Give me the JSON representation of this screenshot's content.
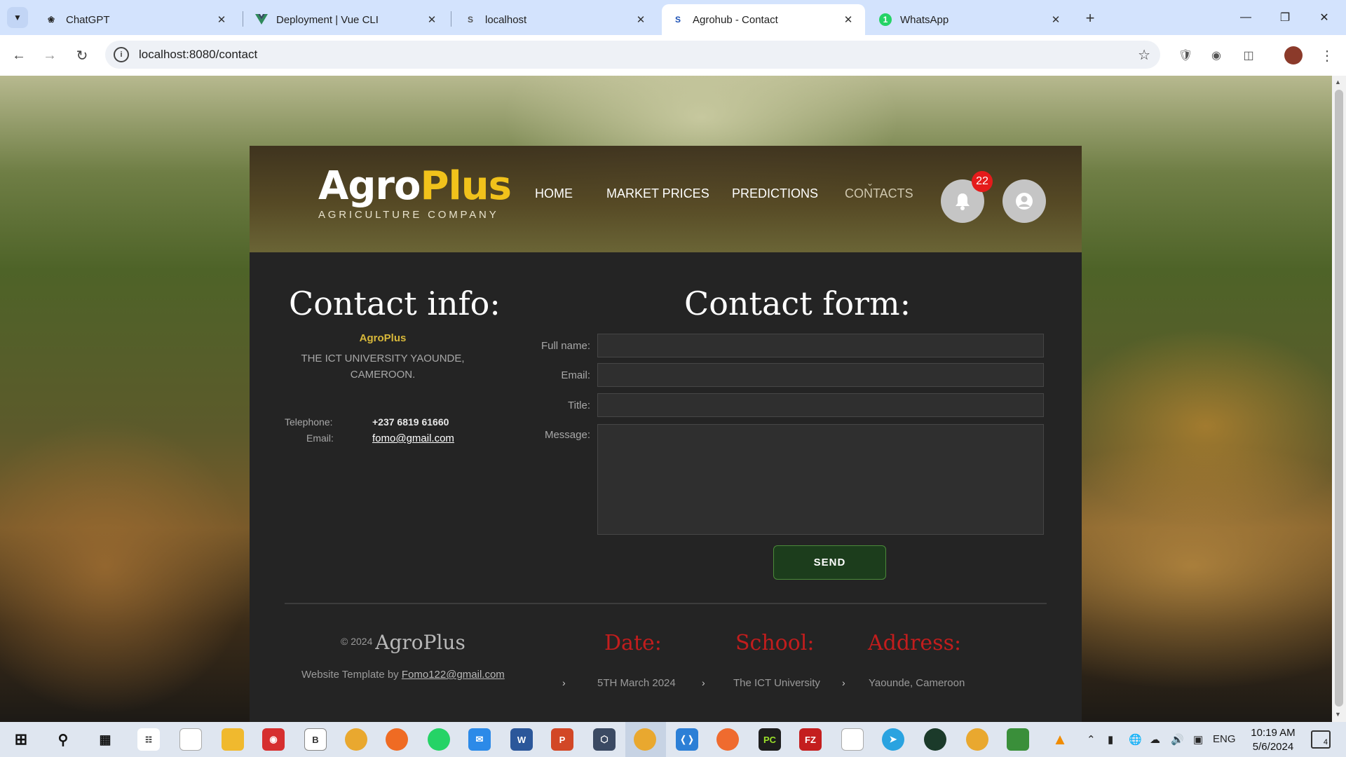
{
  "browser": {
    "tabs": [
      {
        "title": "ChatGPT",
        "favicon": "chatgpt-icon",
        "active": false
      },
      {
        "title": "Deployment | Vue CLI",
        "favicon": "vue-icon",
        "active": false
      },
      {
        "title": "localhost",
        "favicon": "s-icon",
        "active": false
      },
      {
        "title": "Agrohub - Contact",
        "favicon": "s-icon",
        "active": true
      },
      {
        "title": "WhatsApp",
        "favicon": "whatsapp-icon",
        "active": false,
        "badge": "1"
      }
    ],
    "url": "localhost:8080/contact",
    "favicon_letter_s": "S"
  },
  "site": {
    "logo": {
      "part1": "Agro",
      "part2": "Plus",
      "tagline": "AGRICULTURE COMPANY"
    },
    "nav": [
      {
        "label": "HOME",
        "current": false
      },
      {
        "label": "MARKET PRICES",
        "current": false
      },
      {
        "label": "PREDICTIONS",
        "current": false
      },
      {
        "label": "CONTACTS",
        "current": true
      }
    ],
    "notifications_count": "22",
    "contact_info": {
      "title": "Contact info:",
      "company": "AgroPlus",
      "address": "THE ICT UNIVERSITY YAOUNDE, CAMEROON.",
      "telephone_label": "Telephone:",
      "telephone": "+237 6819 61660",
      "email_label": "Email:",
      "email": "fomo@gmail.com"
    },
    "contact_form": {
      "title": "Contact form:",
      "fields": [
        {
          "label": "Full name:",
          "value": ""
        },
        {
          "label": "Email:",
          "value": ""
        },
        {
          "label": "Title:",
          "value": ""
        }
      ],
      "message_label": "Message:",
      "message_value": "",
      "send_label": "SEND"
    },
    "footer": {
      "copyright": "© 2024",
      "brand": "AgroPlus",
      "template_prefix": "Website Template by",
      "template_link": "Fomo122@gmail.com",
      "date_head": "Date:",
      "date_value": "5TH March 2024",
      "school_head": "School:",
      "school_value": "The ICT University",
      "address_head": "Address:",
      "address_value": "Yaounde, Cameroon"
    }
  },
  "taskbar": {
    "tray_lang": "ENG",
    "time": "10:19 AM",
    "date": "5/6/2024",
    "notification_count": "4"
  },
  "colors": {
    "brand_yellow": "#f1c21b",
    "footer_red": "#c21d1d",
    "send_green": "#1c3d1c",
    "badge_red": "#e51b1b"
  }
}
